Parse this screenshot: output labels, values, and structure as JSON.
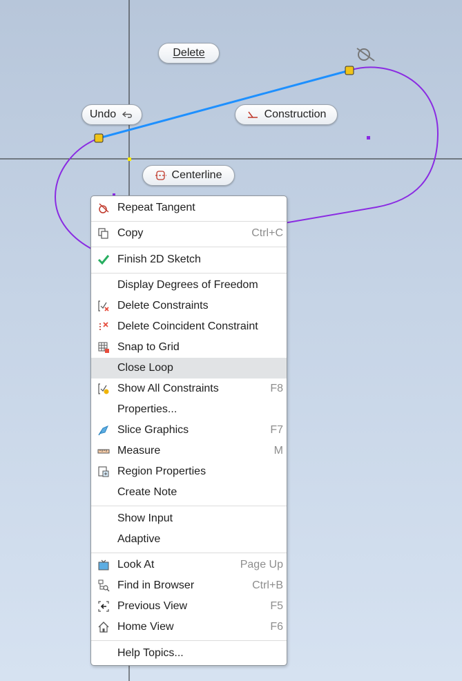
{
  "marking_menu": {
    "delete": "Delete",
    "undo": "Undo",
    "construction": "Construction",
    "centerline": "Centerline"
  },
  "icons": {
    "undo": "undo-arrow-icon",
    "construction": "construction-line-icon",
    "centerline": "centerline-icon",
    "endpoint": "sketch-endpoint-icon",
    "tangent_glyph": "tangent-constraint-icon"
  },
  "colors": {
    "line": "#1e90ff",
    "arc": "#8a2be2",
    "endpoint": "#f0c419",
    "axis": "#222222",
    "shortcut": "#8d8d8d",
    "highlight": "#e1e3e5"
  },
  "context_menu": {
    "items": [
      {
        "label": "Repeat Tangent",
        "shortcut": "",
        "icon": "tangent-icon"
      },
      {
        "label": "Copy",
        "shortcut": "Ctrl+C",
        "icon": "copy-icon"
      },
      {
        "label": "Finish 2D Sketch",
        "shortcut": "",
        "icon": "checkmark-icon"
      },
      {
        "label": "Display Degrees of Freedom",
        "shortcut": "",
        "icon": ""
      },
      {
        "label": "Delete Constraints",
        "shortcut": "",
        "icon": "delete-constraints-icon"
      },
      {
        "label": "Delete Coincident Constraint",
        "shortcut": "",
        "icon": "delete-coincident-icon"
      },
      {
        "label": "Snap to Grid",
        "shortcut": "",
        "icon": "grid-icon"
      },
      {
        "label": "Close Loop",
        "shortcut": "",
        "icon": ""
      },
      {
        "label": "Show All Constraints",
        "shortcut": "F8",
        "icon": "show-constraints-icon"
      },
      {
        "label": "Properties...",
        "shortcut": "",
        "icon": ""
      },
      {
        "label": "Slice Graphics",
        "shortcut": "F7",
        "icon": "slice-graphics-icon"
      },
      {
        "label": "Measure",
        "shortcut": "M",
        "icon": "ruler-icon"
      },
      {
        "label": "Region Properties",
        "shortcut": "",
        "icon": "region-properties-icon"
      },
      {
        "label": "Create Note",
        "shortcut": "",
        "icon": ""
      },
      {
        "label": "Show Input",
        "shortcut": "",
        "icon": ""
      },
      {
        "label": "Adaptive",
        "shortcut": "",
        "icon": ""
      },
      {
        "label": "Look At",
        "shortcut": "Page Up",
        "icon": "look-at-icon"
      },
      {
        "label": "Find in Browser",
        "shortcut": "Ctrl+B",
        "icon": "find-in-browser-icon"
      },
      {
        "label": "Previous View",
        "shortcut": "F5",
        "icon": "previous-view-icon"
      },
      {
        "label": "Home View",
        "shortcut": "F6",
        "icon": "home-icon"
      },
      {
        "label": "Help Topics...",
        "shortcut": "",
        "icon": ""
      }
    ]
  }
}
